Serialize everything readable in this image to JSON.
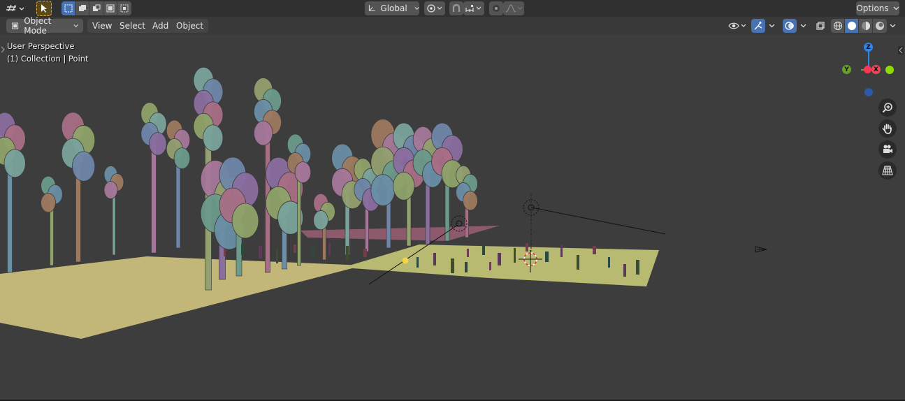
{
  "tool_header": {
    "editor_type_icon": "view3d-editor-icon",
    "select_tool_icon": "cursor-select-icon",
    "select_modes": [
      "select-new-icon",
      "select-extend-icon",
      "select-subtract-icon",
      "select-invert-icon",
      "select-intersect-icon"
    ],
    "transform_orientation": "Global",
    "pivot_icon": "pivot-point-icon",
    "snap_icon": "snap-magnet-icon",
    "snap_target_icon": "snap-increment-icon",
    "proportional_icon": "proportional-edit-icon",
    "falloff_icon": "falloff-curve-icon",
    "options_label": "Options"
  },
  "view_header": {
    "mode_label": "Object Mode",
    "menus": [
      "View",
      "Select",
      "Add",
      "Object"
    ],
    "visibility_icon": "eye-visibility-icon",
    "gizmo_icon": "gizmo-toggle-icon",
    "overlay_icon": "overlay-icon",
    "xray_icon": "xray-icon",
    "shading_modes": [
      "wireframe-shading-icon",
      "solid-shading-icon",
      "material-shading-icon",
      "rendered-shading-icon"
    ]
  },
  "viewport": {
    "perspective_label": "User Perspective",
    "collection_label": "(1) Collection | Point"
  },
  "gizmo": {
    "z_label": "Z",
    "y_label": "Y",
    "x_label": "X",
    "colors": {
      "x": "#e84a59",
      "y": "#6a9e2c",
      "z": "#2f85e8",
      "neg_x": "#ff3352",
      "neg_y": "#8bdc00",
      "neg_z": "#2a5aa8"
    }
  },
  "nav_buttons": [
    "zoom-icon",
    "pan-hand-icon",
    "camera-view-icon",
    "perspective-grid-icon"
  ],
  "colors": {
    "viewport_bg": "#3d3d3d",
    "header_bg": "#303030",
    "accent": "#4772b3",
    "ground": "#c8c07a",
    "ground_dim": "#b8b56f"
  }
}
